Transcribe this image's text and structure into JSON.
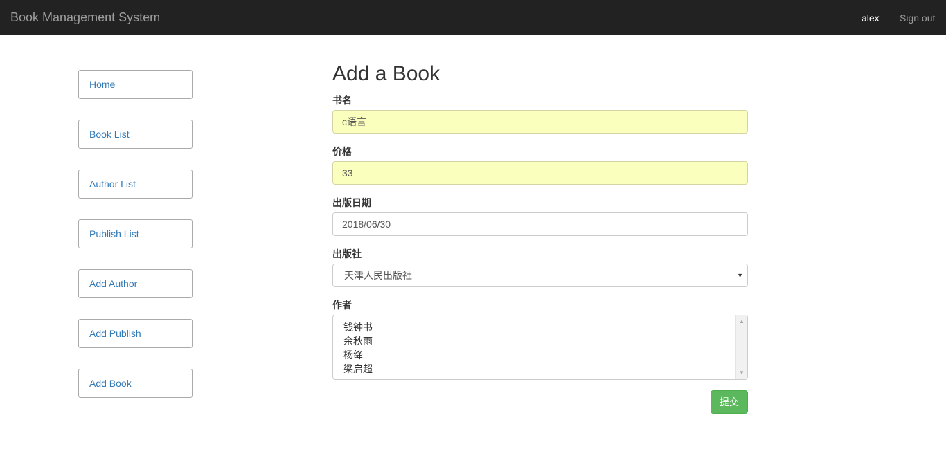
{
  "navbar": {
    "brand": "Book Management System",
    "user": "alex",
    "signout": "Sign out"
  },
  "sidebar": {
    "items": [
      {
        "label": "Home"
      },
      {
        "label": "Book List"
      },
      {
        "label": "Author List"
      },
      {
        "label": "Publish List"
      },
      {
        "label": "Add Author"
      },
      {
        "label": "Add Publish"
      },
      {
        "label": "Add Book"
      }
    ]
  },
  "form": {
    "title": "Add a Book",
    "title_field": {
      "label": "书名",
      "value": "c语言"
    },
    "price_field": {
      "label": "价格",
      "value": "33"
    },
    "date_field": {
      "label": "出版日期",
      "value": "2018/06/30"
    },
    "publisher_field": {
      "label": "出版社",
      "selected": "天津人民出版社"
    },
    "author_field": {
      "label": "作者",
      "options": [
        "钱钟书",
        "余秋雨",
        "杨绛",
        "梁启超"
      ]
    },
    "submit_label": "提交"
  },
  "colors": {
    "navbar_bg": "#222222",
    "link": "#337ab7",
    "autofill_bg": "#faffbd",
    "submit_bg": "#5cb85c"
  }
}
